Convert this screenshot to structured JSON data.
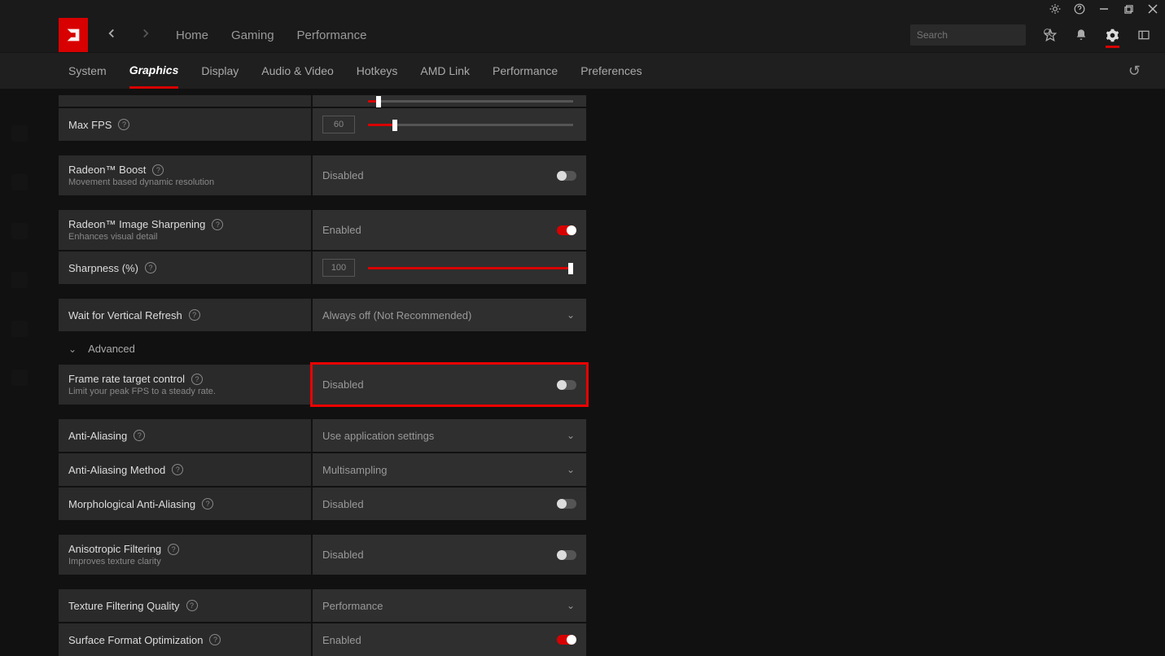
{
  "titlebar": {
    "bug": "⚙",
    "help": "?"
  },
  "search": {
    "placeholder": "Search"
  },
  "mainTabs": {
    "home": "Home",
    "gaming": "Gaming",
    "performance": "Performance"
  },
  "subTabs": {
    "system": "System",
    "graphics": "Graphics",
    "display": "Display",
    "av": "Audio & Video",
    "hotkeys": "Hotkeys",
    "amdlink": "AMD Link",
    "performance": "Performance",
    "preferences": "Preferences"
  },
  "rows": {
    "maxfps": {
      "label": "Max FPS",
      "value": "60"
    },
    "boost": {
      "label": "Radeon™ Boost",
      "sub": "Movement based dynamic resolution",
      "value": "Disabled"
    },
    "sharpen": {
      "label": "Radeon™ Image Sharpening",
      "sub": "Enhances visual detail",
      "value": "Enabled"
    },
    "sharpness": {
      "label": "Sharpness (%)",
      "value": "100"
    },
    "vsync": {
      "label": "Wait for Vertical Refresh",
      "value": "Always off (Not Recommended)"
    },
    "advanced": "Advanced",
    "frtc": {
      "label": "Frame rate target control",
      "sub": "Limit your peak FPS to a steady rate.",
      "value": "Disabled"
    },
    "aa": {
      "label": "Anti-Aliasing",
      "value": "Use application settings"
    },
    "aamethod": {
      "label": "Anti-Aliasing Method",
      "value": "Multisampling"
    },
    "mlaa": {
      "label": "Morphological Anti-Aliasing",
      "value": "Disabled"
    },
    "aniso": {
      "label": "Anisotropic Filtering",
      "sub": "Improves texture clarity",
      "value": "Disabled"
    },
    "texq": {
      "label": "Texture Filtering Quality",
      "value": "Performance"
    },
    "sfo": {
      "label": "Surface Format Optimization",
      "value": "Enabled"
    }
  }
}
